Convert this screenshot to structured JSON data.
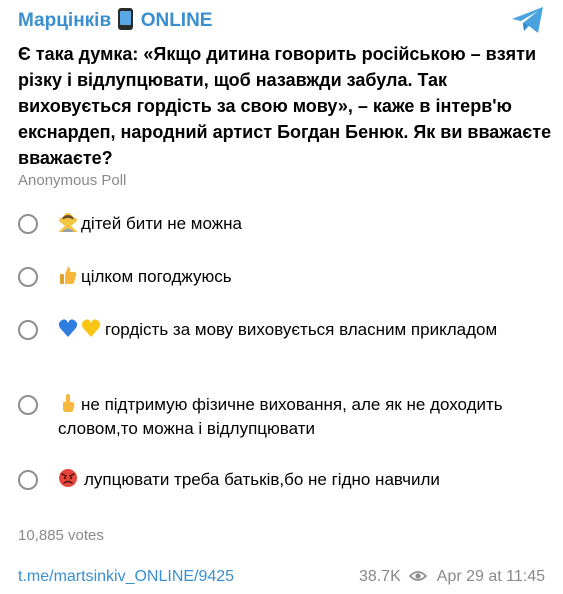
{
  "channel": {
    "name": "Марцінків",
    "suffix": "ONLINE",
    "accent": "#3a8fd0",
    "phone_icon": "mobile-phone-icon",
    "app_icon": "telegram-icon"
  },
  "poll": {
    "question": "Є така думка: «Якщо дитина говорить російською – взяти різку і відлупцювати, щоб назавжди забула. Так виховується гордість за свою мову», – каже в інтерв'ю екснардеп, народний артист Богдан Бенюк. Як ви вважаєте вважаєте?",
    "type": "Anonymous Poll",
    "options": [
      {
        "icon": "person-gesturing-no-icon",
        "text": "дітей бити не можна"
      },
      {
        "icon": "thumbs-up-icon",
        "text": "цілком погоджуюсь"
      },
      {
        "icon": "blue-yellow-hearts-icon",
        "text": "гордість за мову виховується власним прикладом"
      },
      {
        "icon": "index-pointing-up-icon",
        "text": "не підтримую фізичне виховання, але як не доходить словом,то можна і відлупцювати"
      },
      {
        "icon": "angry-face-icon",
        "text": "лупцювати треба батьків,бо не гідно навчили"
      }
    ],
    "votes": "10,885 votes"
  },
  "footer": {
    "link": "t.me/martsinkiv_ONLINE/9425",
    "views": "38.7K",
    "views_icon": "eye-icon",
    "date": "Apr 29 at 11:45"
  }
}
